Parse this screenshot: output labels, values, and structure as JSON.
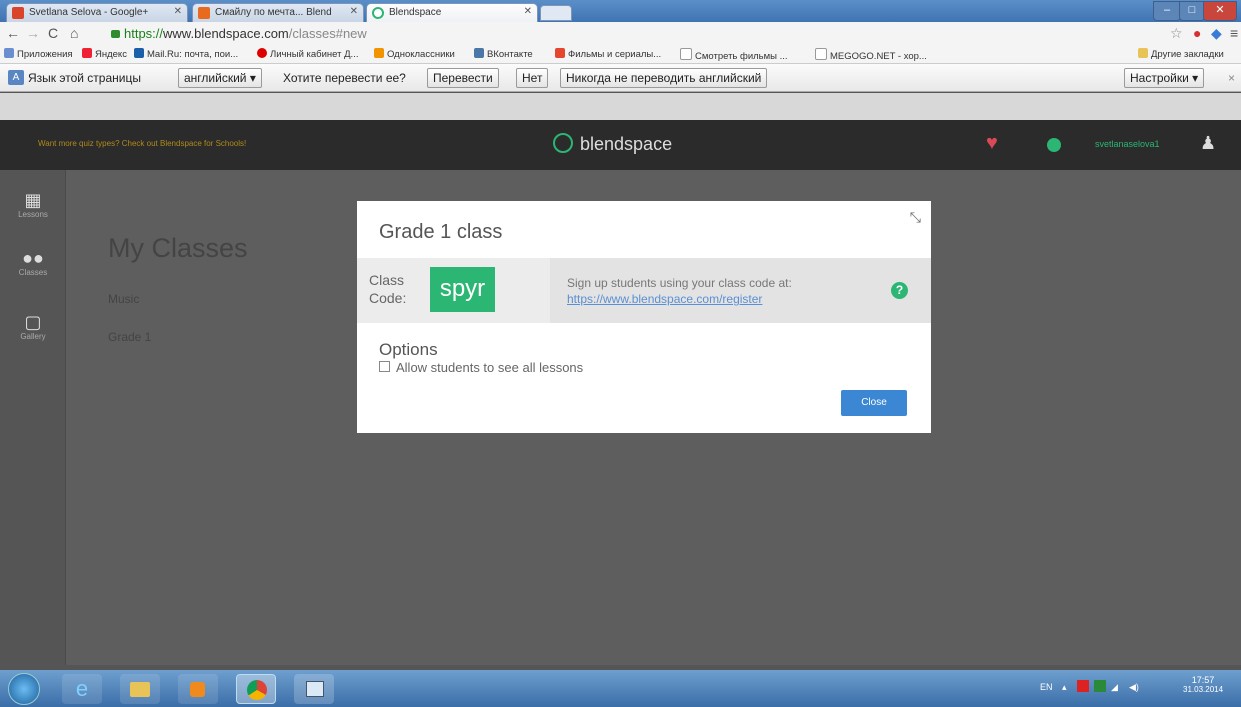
{
  "browser": {
    "tabs": [
      {
        "title": "Svetlana Selova - Google+",
        "color": "#d9442b"
      },
      {
        "title": "Смайлу по мечта... Blend",
        "color": "#e86a1f"
      },
      {
        "title": "Blendspace",
        "color": "#2bb673",
        "active": true
      }
    ],
    "address": {
      "scheme": "https://",
      "host": "www.blendspace.com",
      "path": "/classes#new"
    },
    "bookmarks": [
      "Приложения",
      "Яндекс",
      "Mail.Ru: почта, пои...",
      "Личный кабинет Д...",
      "Одноклассники",
      "ВКонтакте",
      "Фильмы и сериалы...",
      "Смотреть фильмы ...",
      "MEGOGO.NET - хор...",
      "Другие закладки"
    ],
    "translate": {
      "lead": "Язык этой страницы",
      "language": "английский",
      "question": "Хотите перевести ее?",
      "translate_btn": "Перевести",
      "no_btn": "Нет",
      "never_btn": "Никогда не переводить английский",
      "settings_btn": "Настройки"
    }
  },
  "app": {
    "promo": "Want more quiz types? Check out Blendspace for Schools!",
    "logo": "blendspace",
    "username": "svetlanaselova1",
    "sidebar": [
      {
        "label": "Lessons",
        "icon": "grid-icon"
      },
      {
        "label": "Classes",
        "icon": "people-icon"
      },
      {
        "label": "Gallery",
        "icon": "gallery-icon"
      }
    ],
    "page_title": "My Classes",
    "classes": [
      "Music",
      "Grade 1"
    ]
  },
  "modal": {
    "title": "Grade 1 class",
    "class_label": "Class Code:",
    "class_code": "spyr",
    "signup_text": "Sign up students using your class code at:",
    "signup_link": "https://www.blendspace.com/register",
    "options_title": "Options",
    "allow_label": "Allow students to see all lessons",
    "close_label": "Close"
  },
  "taskbar": {
    "lang": "EN",
    "time": "17:57",
    "date": "31.03.2014"
  }
}
